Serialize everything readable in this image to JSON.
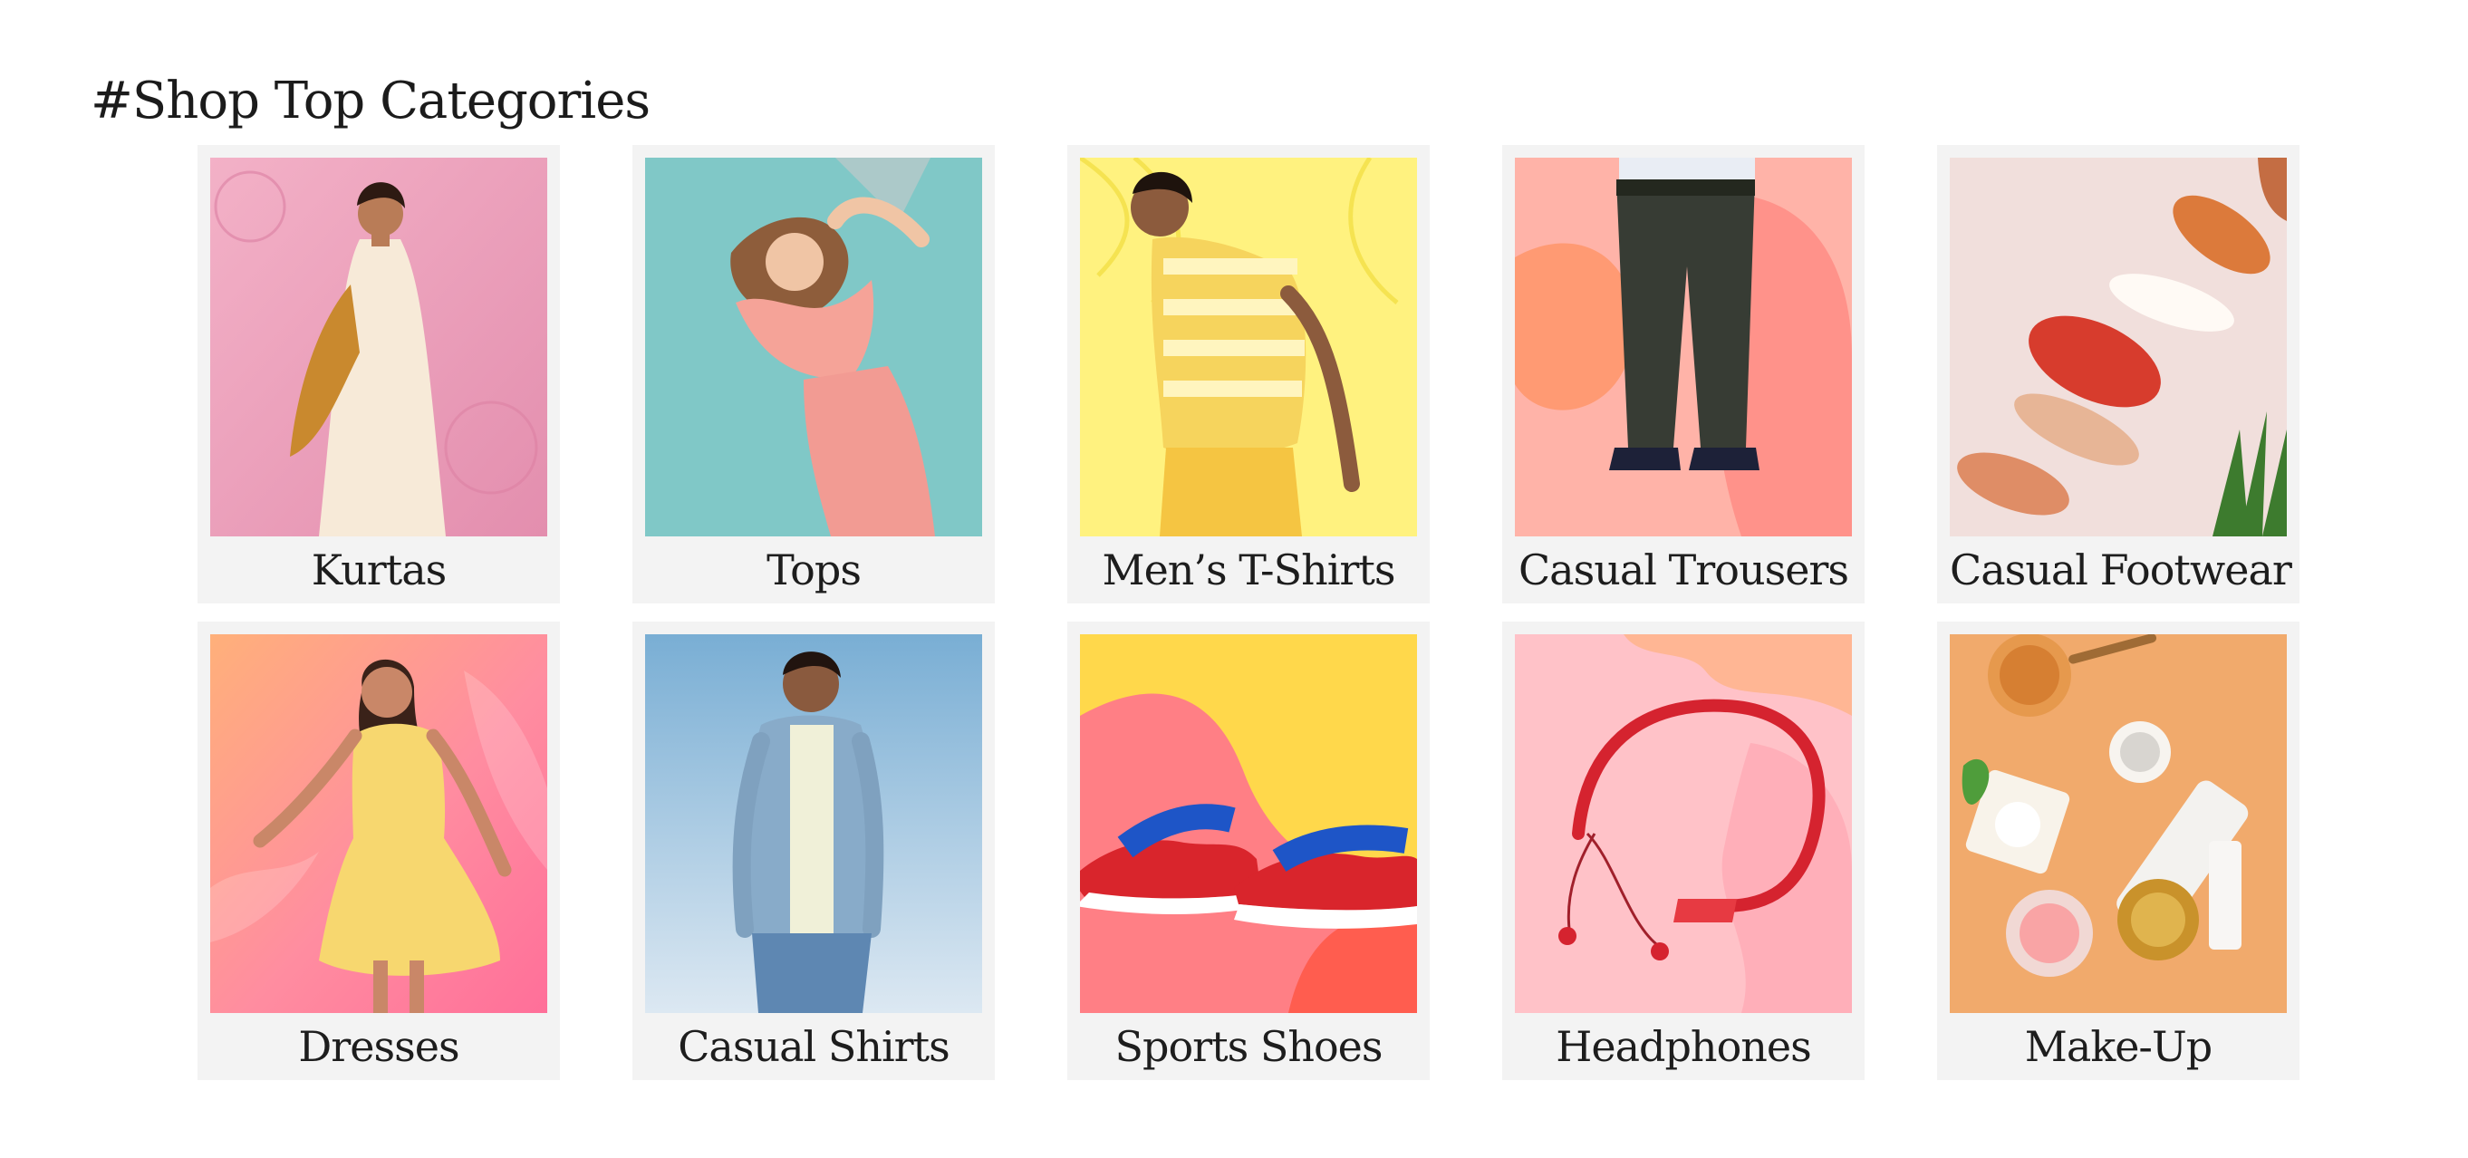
{
  "section": {
    "title": "#Shop Top Categories"
  },
  "categories": [
    {
      "label": "Kurtas",
      "icon": "kurta-model-photo",
      "bg": [
        "#f0a7c3",
        "#e592b1"
      ]
    },
    {
      "label": "Tops",
      "icon": "top-model-photo",
      "bg": [
        "#7fc9c8",
        "#67b7b8"
      ]
    },
    {
      "label": "Men’s T-Shirts",
      "icon": "mens-tshirt-model-photo",
      "bg": [
        "#fff48a",
        "#f6e35a"
      ]
    },
    {
      "label": "Casual Trousers",
      "icon": "trousers-model-photo",
      "bg": [
        "#ffb0a0",
        "#ff8d74"
      ]
    },
    {
      "label": "Casual Footwear",
      "icon": "footwear-flatlay-photo",
      "bg": [
        "#f1dfdb",
        "#e8d0cc"
      ]
    },
    {
      "label": "Dresses",
      "icon": "dress-model-photo",
      "bg": [
        "#ff9dac",
        "#ff7d8e"
      ]
    },
    {
      "label": "Casual Shirts",
      "icon": "casual-shirt-model-photo",
      "bg": [
        "#8eb8d6",
        "#dce8f0"
      ]
    },
    {
      "label": "Sports Shoes",
      "icon": "sports-shoes-photo",
      "bg": [
        "#ffd54a",
        "#ff7c7c"
      ]
    },
    {
      "label": "Headphones",
      "icon": "headphones-photo",
      "bg": [
        "#ffc0c6",
        "#ffb39b"
      ]
    },
    {
      "label": "Make-Up",
      "icon": "makeup-flatlay-photo",
      "bg": [
        "#f2ac6a",
        "#e79a5b"
      ]
    }
  ]
}
